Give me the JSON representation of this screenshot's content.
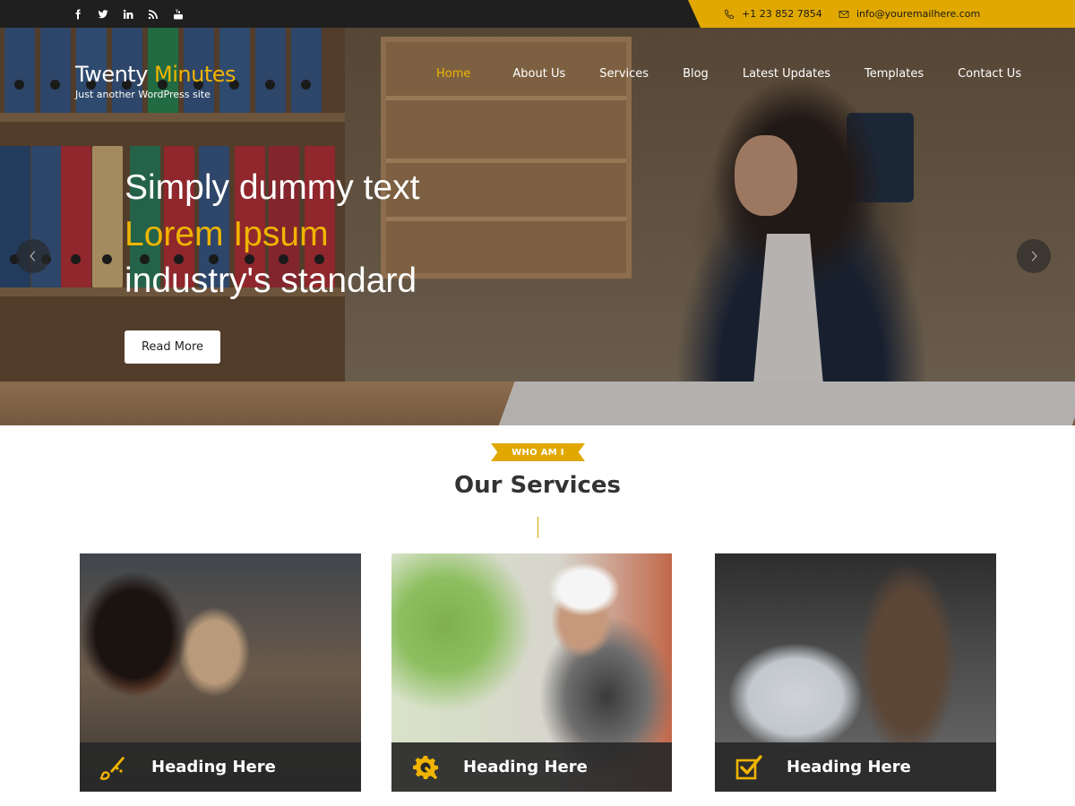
{
  "colors": {
    "accent": "#e0a800",
    "topbar": "#1f1f1f",
    "card_bar": "#282828"
  },
  "topbar": {
    "social": [
      "facebook-icon",
      "twitter-icon",
      "linkedin-icon",
      "rss-icon",
      "youtube-icon"
    ],
    "phone": "+1 23 852 7854",
    "email": "info@youremailhere.com"
  },
  "brand": {
    "title_part1": "Twenty",
    "title_part2": "Minutes",
    "tagline": "Just another WordPress site"
  },
  "nav": {
    "items": [
      {
        "label": "Home",
        "active": true
      },
      {
        "label": "About Us"
      },
      {
        "label": "Services"
      },
      {
        "label": "Blog"
      },
      {
        "label": "Latest Updates"
      },
      {
        "label": "Templates"
      },
      {
        "label": "Contact Us"
      }
    ]
  },
  "hero": {
    "line1": "Simply dummy text",
    "line2": "Lorem Ipsum",
    "line3": "industry's standard",
    "button": "Read More"
  },
  "services": {
    "badge": "WHO AM I",
    "title": "Our Services",
    "cards": [
      {
        "heading": "Heading Here",
        "icon": "paint-brush-icon"
      },
      {
        "heading": "Heading Here",
        "icon": "gear-wrench-icon"
      },
      {
        "heading": "Heading Here",
        "icon": "checkbox-icon"
      }
    ]
  }
}
